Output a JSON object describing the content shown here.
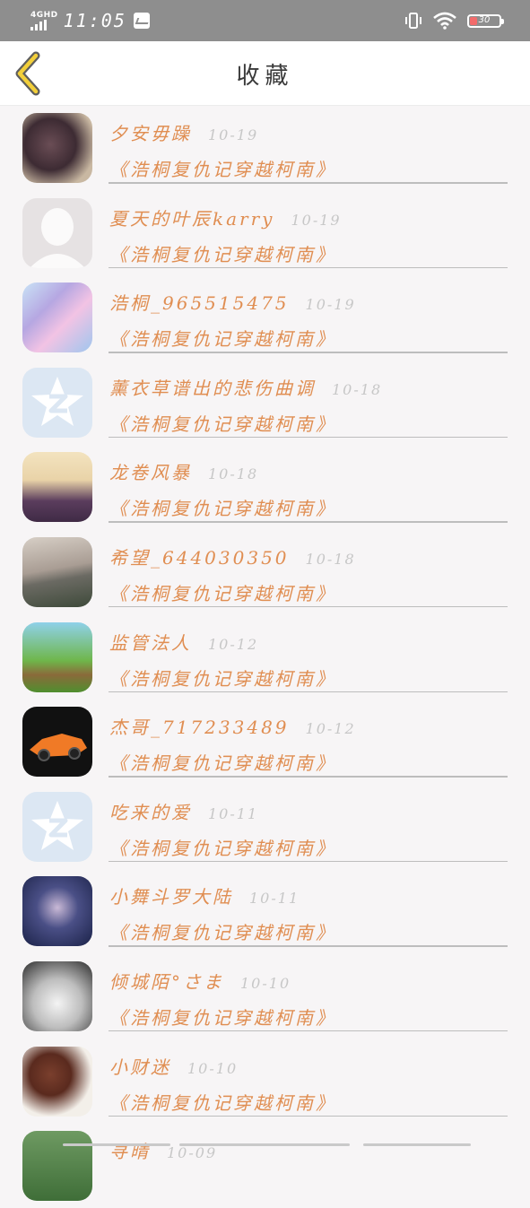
{
  "status_bar": {
    "network": "4GHD",
    "time": "11:05",
    "battery": "30",
    "icons": [
      "signal-icon",
      "message-icon",
      "vibrate-icon",
      "wifi-icon",
      "battery-icon"
    ]
  },
  "header": {
    "title": "收藏",
    "back_icon": "chevron-left-icon"
  },
  "colors": {
    "accent": "#e08e52",
    "date": "#c7c7c7",
    "battery_low": "#f26b6b"
  },
  "items": [
    {
      "name": "夕安毋躁",
      "date": "10-19",
      "post": "《浩桐复仇记穿越柯南》"
    },
    {
      "name": "夏天的叶辰karry",
      "date": "10-19",
      "post": "《浩桐复仇记穿越柯南》"
    },
    {
      "name": "浩桐_965515475",
      "date": "10-19",
      "post": "《浩桐复仇记穿越柯南》"
    },
    {
      "name": "薰衣草谱出的悲伤曲调",
      "date": "10-18",
      "post": "《浩桐复仇记穿越柯南》"
    },
    {
      "name": "龙卷风暴",
      "date": "10-18",
      "post": "《浩桐复仇记穿越柯南》"
    },
    {
      "name": "希望_644030350",
      "date": "10-18",
      "post": "《浩桐复仇记穿越柯南》"
    },
    {
      "name": "监管法人",
      "date": "10-12",
      "post": "《浩桐复仇记穿越柯南》"
    },
    {
      "name": "杰哥_717233489",
      "date": "10-12",
      "post": "《浩桐复仇记穿越柯南》"
    },
    {
      "name": "吃来的爱",
      "date": "10-11",
      "post": "《浩桐复仇记穿越柯南》"
    },
    {
      "name": "小舞斗罗大陆",
      "date": "10-11",
      "post": "《浩桐复仇记穿越柯南》"
    },
    {
      "name": "倾城陌°さま",
      "date": "10-10",
      "post": "《浩桐复仇记穿越柯南》"
    },
    {
      "name": "小财迷",
      "date": "10-10",
      "post": "《浩桐复仇记穿越柯南》"
    },
    {
      "name": "寻晴",
      "date": "10-09",
      "post": ""
    }
  ]
}
